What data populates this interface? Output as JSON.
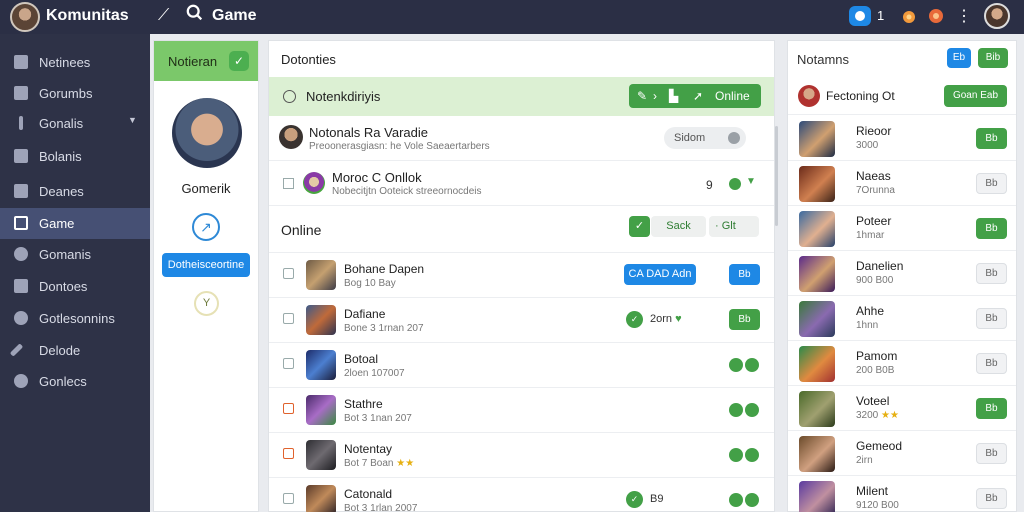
{
  "topbar": {
    "app_title": "Komunitas",
    "section_title": "Game",
    "notification_count": "1"
  },
  "sidebar": {
    "items": [
      {
        "label": "Netinees",
        "icon": "home-icon",
        "active": false,
        "caret": false
      },
      {
        "label": "Gorumbs",
        "icon": "users-icon",
        "active": false,
        "caret": false
      },
      {
        "label": "Gonalis",
        "icon": "pin-icon",
        "active": false,
        "caret": true
      },
      {
        "label": "Bolanis",
        "icon": "folder-icon",
        "active": false,
        "caret": false
      },
      {
        "label": "Deanes",
        "icon": "briefcase-icon",
        "active": false,
        "caret": false
      },
      {
        "label": "Game",
        "icon": "grid-icon",
        "active": true,
        "caret": false
      },
      {
        "label": "Gomanis",
        "icon": "search-icon",
        "active": false,
        "caret": false
      },
      {
        "label": "Dontoes",
        "icon": "building-icon",
        "active": false,
        "caret": false
      },
      {
        "label": "Gotlesonnins",
        "icon": "chat-icon",
        "active": false,
        "caret": false
      },
      {
        "label": "Delode",
        "icon": "wand-icon",
        "active": false,
        "caret": false
      },
      {
        "label": "Gonlecs",
        "icon": "globe-icon",
        "active": false,
        "caret": false
      }
    ]
  },
  "profile": {
    "header_title": "Notieran",
    "name": "Gomerik",
    "action_label": "Dotheisceortine"
  },
  "main": {
    "title": "Dotonties",
    "notif_label": "Notenkdiriyis",
    "notif_tools_label": "Online",
    "featured": [
      {
        "name": "Notonals Ra Varadie",
        "sub": "Preoonerasgiasn: he Vole Saeaertarbers",
        "pill": "Sidom"
      },
      {
        "name": "Moroc C Onllok",
        "sub": "Nobecitjtn Ooteick streeornocdeis",
        "count": "9"
      }
    ],
    "online_label": "Online",
    "online_btn_1": "Sack",
    "online_btn_2": "Glt",
    "rows": [
      {
        "name": "Bohane Dapen",
        "sub": "Bog 10 Bay",
        "action": "CA DAD Adn",
        "side": "Bb",
        "kind": "blue"
      },
      {
        "name": "Dafiane",
        "sub": "Bone 3 1rnan 207",
        "mid": "2orn",
        "side": "Bb",
        "kind": "green"
      },
      {
        "name": "Botoal",
        "sub": "2loen 107007",
        "kind": "dual"
      },
      {
        "name": "Stathre",
        "sub": "Bot 3 1nan 207",
        "kind": "dual"
      },
      {
        "name": "Notentay",
        "sub": "Bot 7 Boan",
        "kind": "dual"
      },
      {
        "name": "Catonald",
        "sub": "Bot 3 1rlan 2007",
        "mid": "B9",
        "kind": "dual-mid"
      }
    ]
  },
  "right": {
    "title": "Notamns",
    "btn_1": "Eb",
    "btn_2": "Bib",
    "summary_label": "Fectoning Ot",
    "summary_btn": "Goan Eab",
    "list": [
      {
        "name": "Rieoor",
        "sub": "3000",
        "btn": "Bb",
        "style": "green"
      },
      {
        "name": "Naeas",
        "sub": "7Orunna",
        "btn": "Bb",
        "style": "white"
      },
      {
        "name": "Poteer",
        "sub": "1hmar",
        "btn": "Bb",
        "style": "green"
      },
      {
        "name": "Danelien",
        "sub": "900 B00",
        "btn": "Bb",
        "style": "white"
      },
      {
        "name": "Ahhe",
        "sub": "1hnn",
        "btn": "Bb",
        "style": "white"
      },
      {
        "name": "Pamom",
        "sub": "200 B0B",
        "btn": "Bb",
        "style": "white"
      },
      {
        "name": "Voteel",
        "sub": "3200",
        "btn": "Bb",
        "style": "green"
      },
      {
        "name": "Gemeod",
        "sub": "2irn",
        "btn": "Bb",
        "style": "white"
      },
      {
        "name": "Milent",
        "sub": "9120 B00",
        "btn": "Bb",
        "style": "white"
      }
    ]
  },
  "colors": {
    "accent_green": "#43a047",
    "accent_blue": "#1e88e5",
    "sidebar_bg": "#2e3247"
  }
}
